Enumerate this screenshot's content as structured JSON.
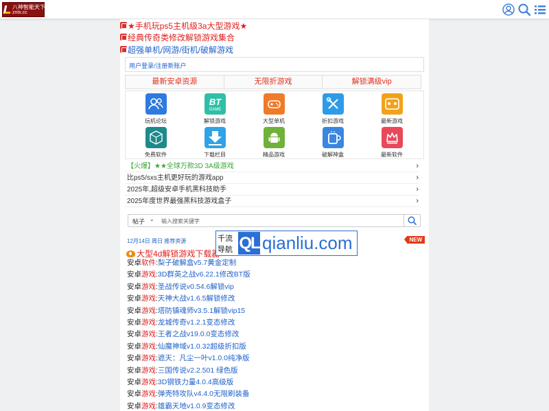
{
  "header": {
    "logo_text": "八神智能天下",
    "logo_domain": "zntx.cc",
    "icons": [
      "user-icon",
      "search-icon",
      "menu-list-icon"
    ]
  },
  "headline_links": [
    {
      "text": "★手机玩ps5主机级3a大型游戏★",
      "color": "#e02020"
    },
    {
      "text": "经典传奇类修改解锁游戏集合",
      "color": "#e02020"
    },
    {
      "text": "超强单机/网游/街机/破解游戏",
      "color": "#1f62c9"
    }
  ],
  "login": {
    "label": "用户登录/注册新账户"
  },
  "tabs": [
    "最新安卓资源",
    "无限折游戏",
    "解锁满级vip"
  ],
  "grid": [
    {
      "label": "玩机论坛",
      "icon": "forum-users-icon",
      "color": "#2e7be0"
    },
    {
      "label": "解锁游戏",
      "icon": "bt-game-icon",
      "color": "#2fbfa8"
    },
    {
      "label": "大型单机",
      "icon": "gamepad-icon",
      "color": "#f07a28"
    },
    {
      "label": "折扣游戏",
      "icon": "tools-icon",
      "color": "#2e9be8"
    },
    {
      "label": "最新游戏",
      "icon": "controller-icon",
      "color": "#f2a21a"
    },
    {
      "label": "免费软件",
      "icon": "cube-icon",
      "color": "#1e8a8a"
    },
    {
      "label": "下载栏目",
      "icon": "download-icon",
      "color": "#2fa3e6"
    },
    {
      "label": "精品游戏",
      "icon": "android-icon",
      "color": "#6fb13a"
    },
    {
      "label": "破解神盒",
      "icon": "box-icon",
      "color": "#3a86e0"
    },
    {
      "label": "最新软件",
      "icon": "crown-icon",
      "color": "#e8485a"
    }
  ],
  "news": [
    {
      "prefix": "【火爆】",
      "text": "★★全球万款3D 3A级游戏",
      "color": "#3aa63a"
    },
    {
      "prefix": "",
      "text": "比ps5/sxs主机更好玩的游戏app",
      "color": "#333"
    },
    {
      "prefix": "",
      "text": "2025年,超级安卓手机黑科技助手",
      "color": "#333"
    },
    {
      "prefix": "",
      "text": "2025年度世界最强黑科技游戏盒子",
      "color": "#333"
    }
  ],
  "search": {
    "category": "帖子",
    "placeholder": "输入搜索关键字"
  },
  "recommend": {
    "date": "12月14日 周日 推荐资源",
    "title": "大型4d解锁游戏下载器",
    "badge": "NEW"
  },
  "watermark": {
    "cn_line1": "千流",
    "cn_line2": "导航",
    "ql": "QL",
    "text": "qianliu.com"
  },
  "games": [
    {
      "pre": "安卓",
      "kind": "软件",
      "title": "梨子破解盒v5.7黄金定制"
    },
    {
      "pre": "安卓",
      "kind": "游戏",
      "title": "3D群英之战v6.22.1修改BT版"
    },
    {
      "pre": "安卓",
      "kind": "游戏",
      "title": "圣战传说v0.54.6解锁vip"
    },
    {
      "pre": "安卓",
      "kind": "游戏",
      "title": "天神大战v1.6.5解锁修改"
    },
    {
      "pre": "安卓",
      "kind": "游戏",
      "title": "塔防镇魂师v3.5.1解锁vip15"
    },
    {
      "pre": "安卓",
      "kind": "游戏",
      "title": "龙城传奇v1.2.1变态修改"
    },
    {
      "pre": "安卓",
      "kind": "游戏",
      "title": "王者之战v19.0.0变态修改"
    },
    {
      "pre": "安卓",
      "kind": "游戏",
      "title": "仙魔神域v1.0.32超级折扣版"
    },
    {
      "pre": "安卓",
      "kind": "游戏",
      "title": "遮天：凡尘一叶v1.0.0纯净版"
    },
    {
      "pre": "安卓",
      "kind": "游戏",
      "title": "三国传说v2.2.501 绿色版"
    },
    {
      "pre": "安卓",
      "kind": "游戏",
      "title": "3D钢铁力量4.0.4高级版"
    },
    {
      "pre": "安卓",
      "kind": "游戏",
      "title": "弹壳特攻队v4.4.0无限刷装备"
    },
    {
      "pre": "安卓",
      "kind": "游戏",
      "title": "雄霸天地v1.0.9变态修改"
    }
  ]
}
